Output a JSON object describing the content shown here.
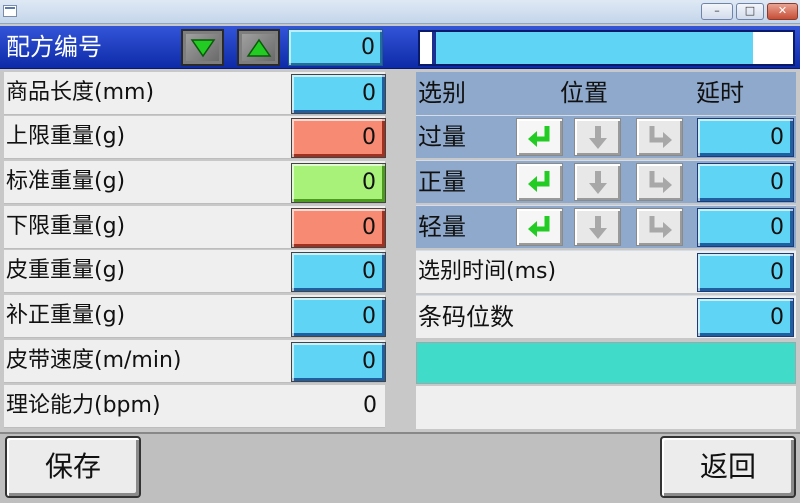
{
  "window": {
    "min_glyph": "–",
    "max_glyph": "□",
    "close_glyph": "✕"
  },
  "header": {
    "title": "配方编号",
    "recipe_number": "0",
    "progress_fraction": 0.86
  },
  "left_rows": [
    {
      "label": "商品长度(mm)",
      "value": "0",
      "style": "blue"
    },
    {
      "label": "上限重量(g)",
      "value": "0",
      "style": "red"
    },
    {
      "label": "标准重量(g)",
      "value": "0",
      "style": "green"
    },
    {
      "label": "下限重量(g)",
      "value": "0",
      "style": "red"
    },
    {
      "label": "皮重重量(g)",
      "value": "0",
      "style": "blue"
    },
    {
      "label": "补正重量(g)",
      "value": "0",
      "style": "blue"
    },
    {
      "label": "皮带速度(m/min)",
      "value": "0",
      "style": "blue"
    },
    {
      "label": "理论能力(bpm)",
      "value": "0",
      "style": "plain"
    }
  ],
  "right_header": {
    "select": "选别",
    "position": "位置",
    "delay": "延时"
  },
  "right_rows": [
    {
      "label": "过量",
      "delay": "0"
    },
    {
      "label": "正量",
      "delay": "0"
    },
    {
      "label": "轻量",
      "delay": "0"
    }
  ],
  "sort_time": {
    "label": "选别时间(ms)",
    "value": "0"
  },
  "barcode_digits": {
    "label": "条码位数",
    "value": "0"
  },
  "buttons": {
    "save": "保存",
    "back": "返回"
  },
  "colors": {
    "header_blue": "#1a3ac0",
    "value_blue": "#60d4f4",
    "limit_red": "#f68a72",
    "standard_green": "#a8f27a",
    "status_teal": "#40dcc9",
    "arrow_green": "#22cc22"
  }
}
